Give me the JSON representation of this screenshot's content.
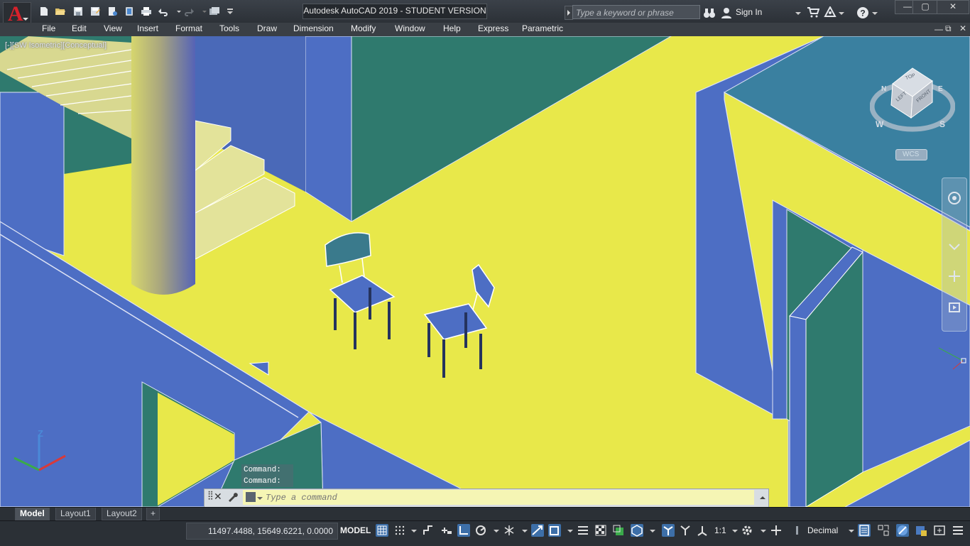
{
  "window": {
    "title": "Autodesk AutoCAD 2019 - STUDENT VERSION",
    "controls": [
      "—",
      "▢",
      "✕"
    ]
  },
  "app_logo": "A",
  "quick_access": [
    "new-icon",
    "open-icon",
    "save-icon",
    "save-as-icon",
    "open-from-web-icon",
    "save-to-web-icon",
    "plot-icon",
    "undo-icon",
    "redo-icon",
    "workspace-icon"
  ],
  "search": {
    "placeholder": "Type a keyword or phrase"
  },
  "user": {
    "signin_label": "Sign In"
  },
  "menu": [
    "File",
    "Edit",
    "View",
    "Insert",
    "Format",
    "Tools",
    "Draw",
    "Dimension",
    "Modify",
    "Window",
    "Help",
    "Express",
    "Parametric"
  ],
  "viewport": {
    "label": "[-][SW Isometric][Conceptual]",
    "viewcube": {
      "top": "TOP",
      "left": "LEFT",
      "front": "FRONT",
      "compass_w": "W",
      "compass_s": "S",
      "compass_n": "N",
      "compass_e": "E"
    },
    "ucs": {
      "label": "WCS",
      "z": "Z"
    }
  },
  "command": {
    "history": [
      "Command:",
      "Command:"
    ],
    "placeholder": "Type a command"
  },
  "layout_tabs": [
    "Model",
    "Layout1",
    "Layout2"
  ],
  "status": {
    "coords": "11497.4488, 15649.6221, 0.0000",
    "mode": "MODEL",
    "scale": "1:1",
    "units": "Decimal"
  },
  "colors": {
    "floor": "#e8e84a",
    "wall_blue": "#4d6ec4",
    "wall_teal": "#2f7a6e",
    "chrome": "#2b3036"
  }
}
